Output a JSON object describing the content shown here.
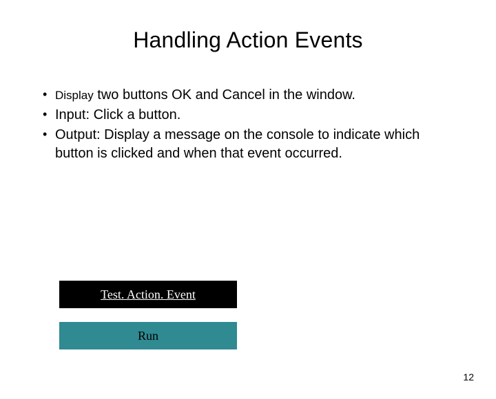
{
  "slide": {
    "title": "Handling Action Events",
    "bullets": [
      {
        "prefix": "Display",
        "rest": " two buttons OK and Cancel in the window."
      },
      {
        "prefix": "",
        "rest": "Input: Click a button."
      },
      {
        "prefix": "",
        "rest": "Output: Display a message on the console to indicate which button is clicked and when that event occurred."
      }
    ],
    "buttons": {
      "black_label": "Test. Action. Event",
      "teal_label": "Run"
    },
    "page_number": "12"
  }
}
